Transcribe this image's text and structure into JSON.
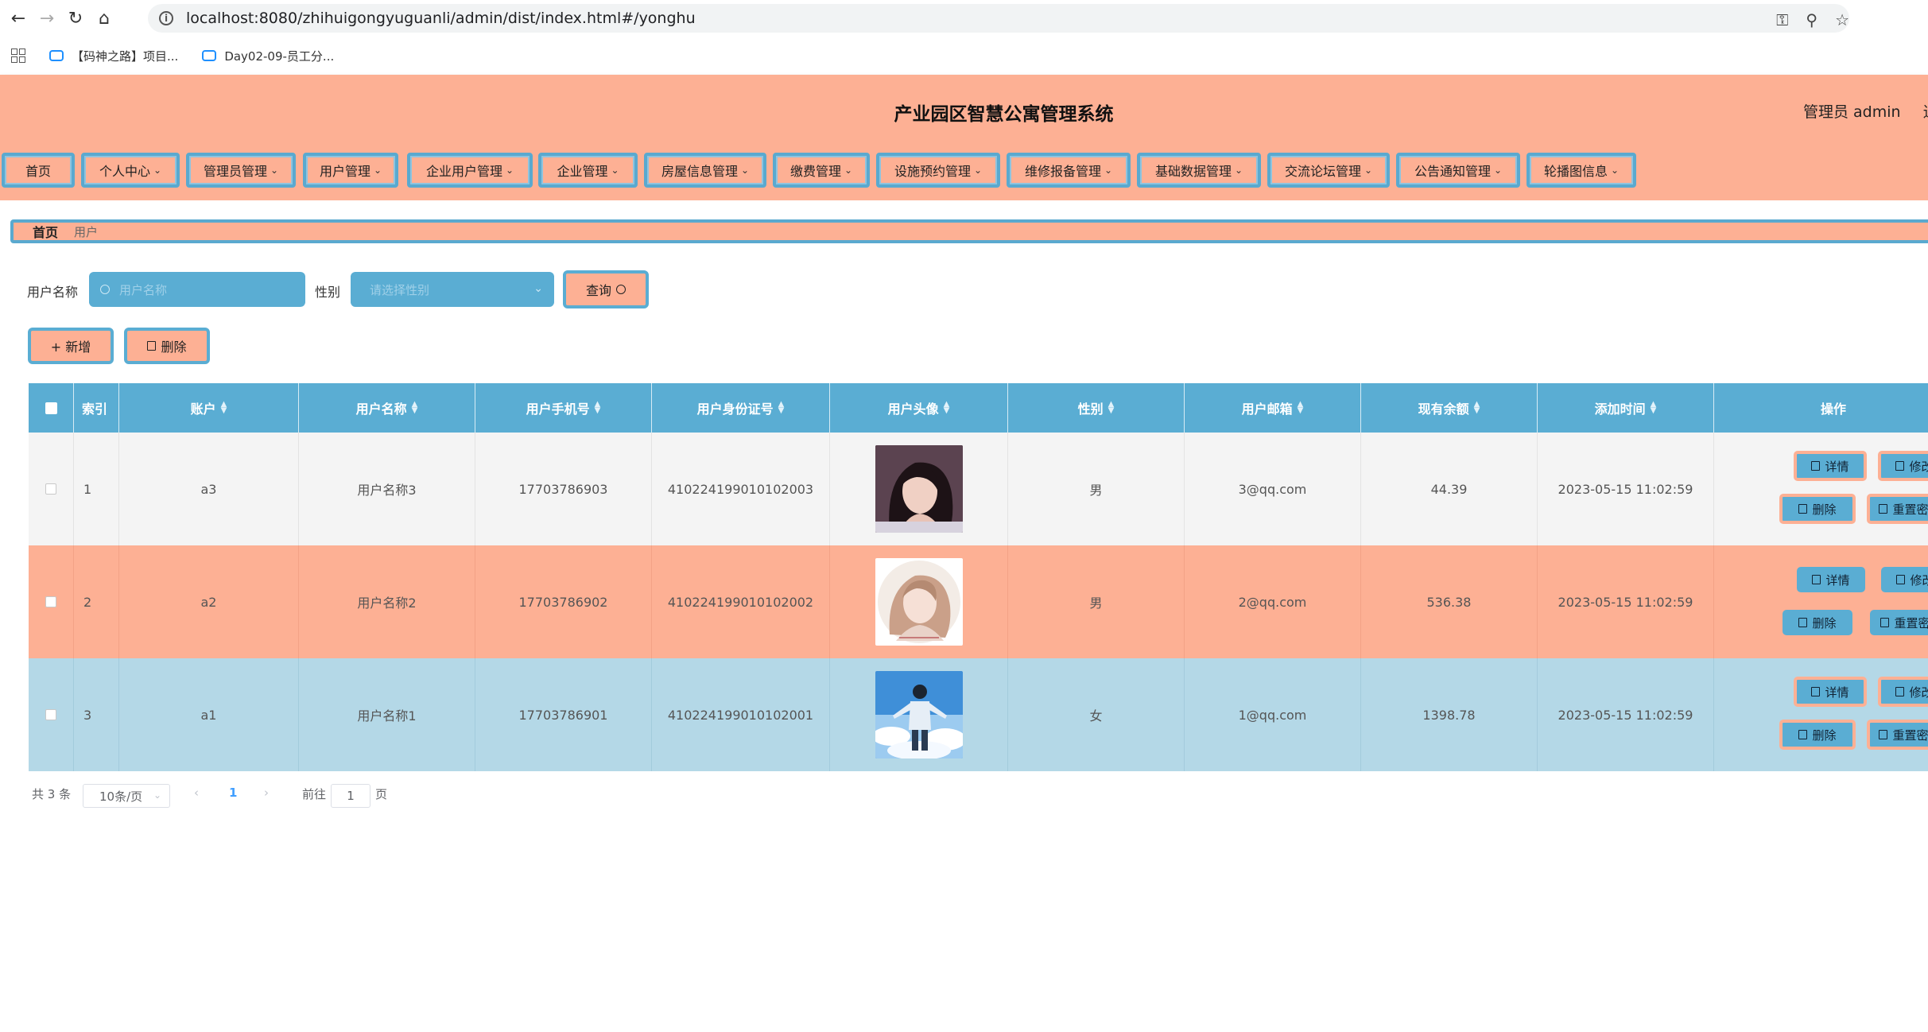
{
  "browser": {
    "url": "localhost:8080/zhihuigongyuguanli/admin/dist/index.html#/yonghu",
    "bookmarks": [
      "【码神之路】项目...",
      "Day02-09-员工分..."
    ]
  },
  "header": {
    "title": "产业园区智慧公寓管理系统",
    "user": "管理员 admin",
    "logout": "退"
  },
  "menu": {
    "items": [
      "首页",
      "个人中心",
      "管理员管理",
      "用户管理",
      "企业用户管理",
      "企业管理",
      "房屋信息管理",
      "缴费管理",
      "设施预约管理",
      "维修报备管理",
      "基础数据管理",
      "交流论坛管理",
      "公告通知管理",
      "轮播图信息"
    ]
  },
  "breadcrumb": {
    "home": "首页",
    "current": "用户"
  },
  "search": {
    "name_label": "用户名称",
    "name_placeholder": "用户名称",
    "gender_label": "性别",
    "gender_placeholder": "请选择性别",
    "query_button": "查询"
  },
  "actions": {
    "add": "+ 新增",
    "delete": "删除"
  },
  "table": {
    "columns": [
      "索引",
      "账户",
      "用户名称",
      "用户手机号",
      "用户身份证号",
      "用户头像",
      "性别",
      "用户邮箱",
      "现有余额",
      "添加时间",
      "操作"
    ],
    "rows": [
      {
        "index": "1",
        "account": "a3",
        "name": "用户名称3",
        "phone": "17703786903",
        "idcard": "410224199010102003",
        "gender": "男",
        "email": "3@qq.com",
        "balance": "44.39",
        "time": "2023-05-15 11:02:59"
      },
      {
        "index": "2",
        "account": "a2",
        "name": "用户名称2",
        "phone": "17703786902",
        "idcard": "410224199010102002",
        "gender": "男",
        "email": "2@qq.com",
        "balance": "536.38",
        "time": "2023-05-15 11:02:59"
      },
      {
        "index": "3",
        "account": "a1",
        "name": "用户名称1",
        "phone": "17703786901",
        "idcard": "410224199010102001",
        "gender": "女",
        "email": "1@qq.com",
        "balance": "1398.78",
        "time": "2023-05-15 11:02:59"
      }
    ],
    "ops": {
      "detail": "详情",
      "edit": "修改",
      "delete": "删除",
      "reset": "重置密码"
    }
  },
  "pagination": {
    "total": "共 3 条",
    "page_size": "10条/页",
    "current": "1",
    "goto_label": "前往",
    "goto_value": "1",
    "page_suffix": "页"
  },
  "colors": {
    "salmon": "#fdb094",
    "blue": "#5aadd3",
    "row_grey": "#f4f4f4",
    "row_blue": "#b4d8e7"
  }
}
